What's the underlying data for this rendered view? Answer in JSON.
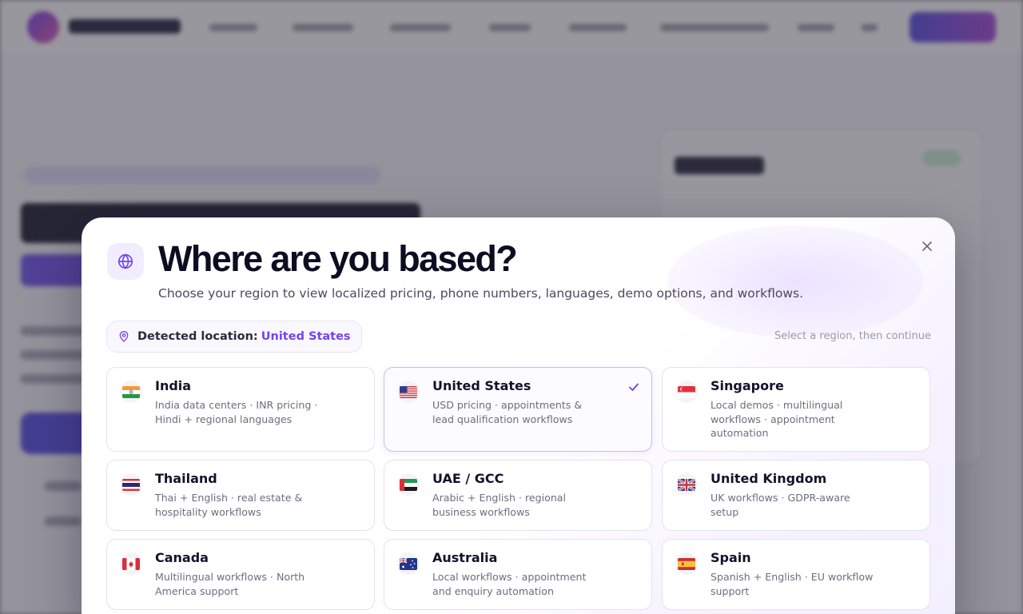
{
  "modal": {
    "title": "Where are you based?",
    "subtitle": "Choose your region to view localized pricing, phone numbers, languages, demo options, and workflows.",
    "close_icon": "close-icon",
    "globe_icon": "globe-icon",
    "detected": {
      "label": "Detected location:",
      "value": "United States",
      "icon": "map-pin-icon"
    },
    "hint": "Select a region, then continue",
    "regions": [
      {
        "name": "India",
        "desc": "India data centers · INR pricing · Hindi + regional languages",
        "flag": "india-flag-icon",
        "selected": false
      },
      {
        "name": "United States",
        "desc": "USD pricing · appointments & lead qualification workflows",
        "flag": "us-flag-icon",
        "selected": true
      },
      {
        "name": "Singapore",
        "desc": "Local demos · multilingual workflows · appointment automation",
        "flag": "singapore-flag-icon",
        "selected": false
      },
      {
        "name": "Thailand",
        "desc": "Thai + English · real estate & hospitality workflows",
        "flag": "thailand-flag-icon",
        "selected": false
      },
      {
        "name": "UAE / GCC",
        "desc": "Arabic + English · regional business workflows",
        "flag": "uae-flag-icon",
        "selected": false
      },
      {
        "name": "United Kingdom",
        "desc": "UK workflows · GDPR-aware setup",
        "flag": "uk-flag-icon",
        "selected": false
      },
      {
        "name": "Canada",
        "desc": "Multilingual workflows · North America support",
        "flag": "canada-flag-icon",
        "selected": false
      },
      {
        "name": "Australia",
        "desc": "Local workflows · appointment and enquiry automation",
        "flag": "australia-flag-icon",
        "selected": false
      },
      {
        "name": "Spain",
        "desc": "Spanish + English · EU workflow support",
        "flag": "spain-flag-icon",
        "selected": false
      }
    ]
  },
  "colors": {
    "accent": "#7245ea",
    "title": "#0d0d22",
    "selected_border": "#c8baf6"
  }
}
